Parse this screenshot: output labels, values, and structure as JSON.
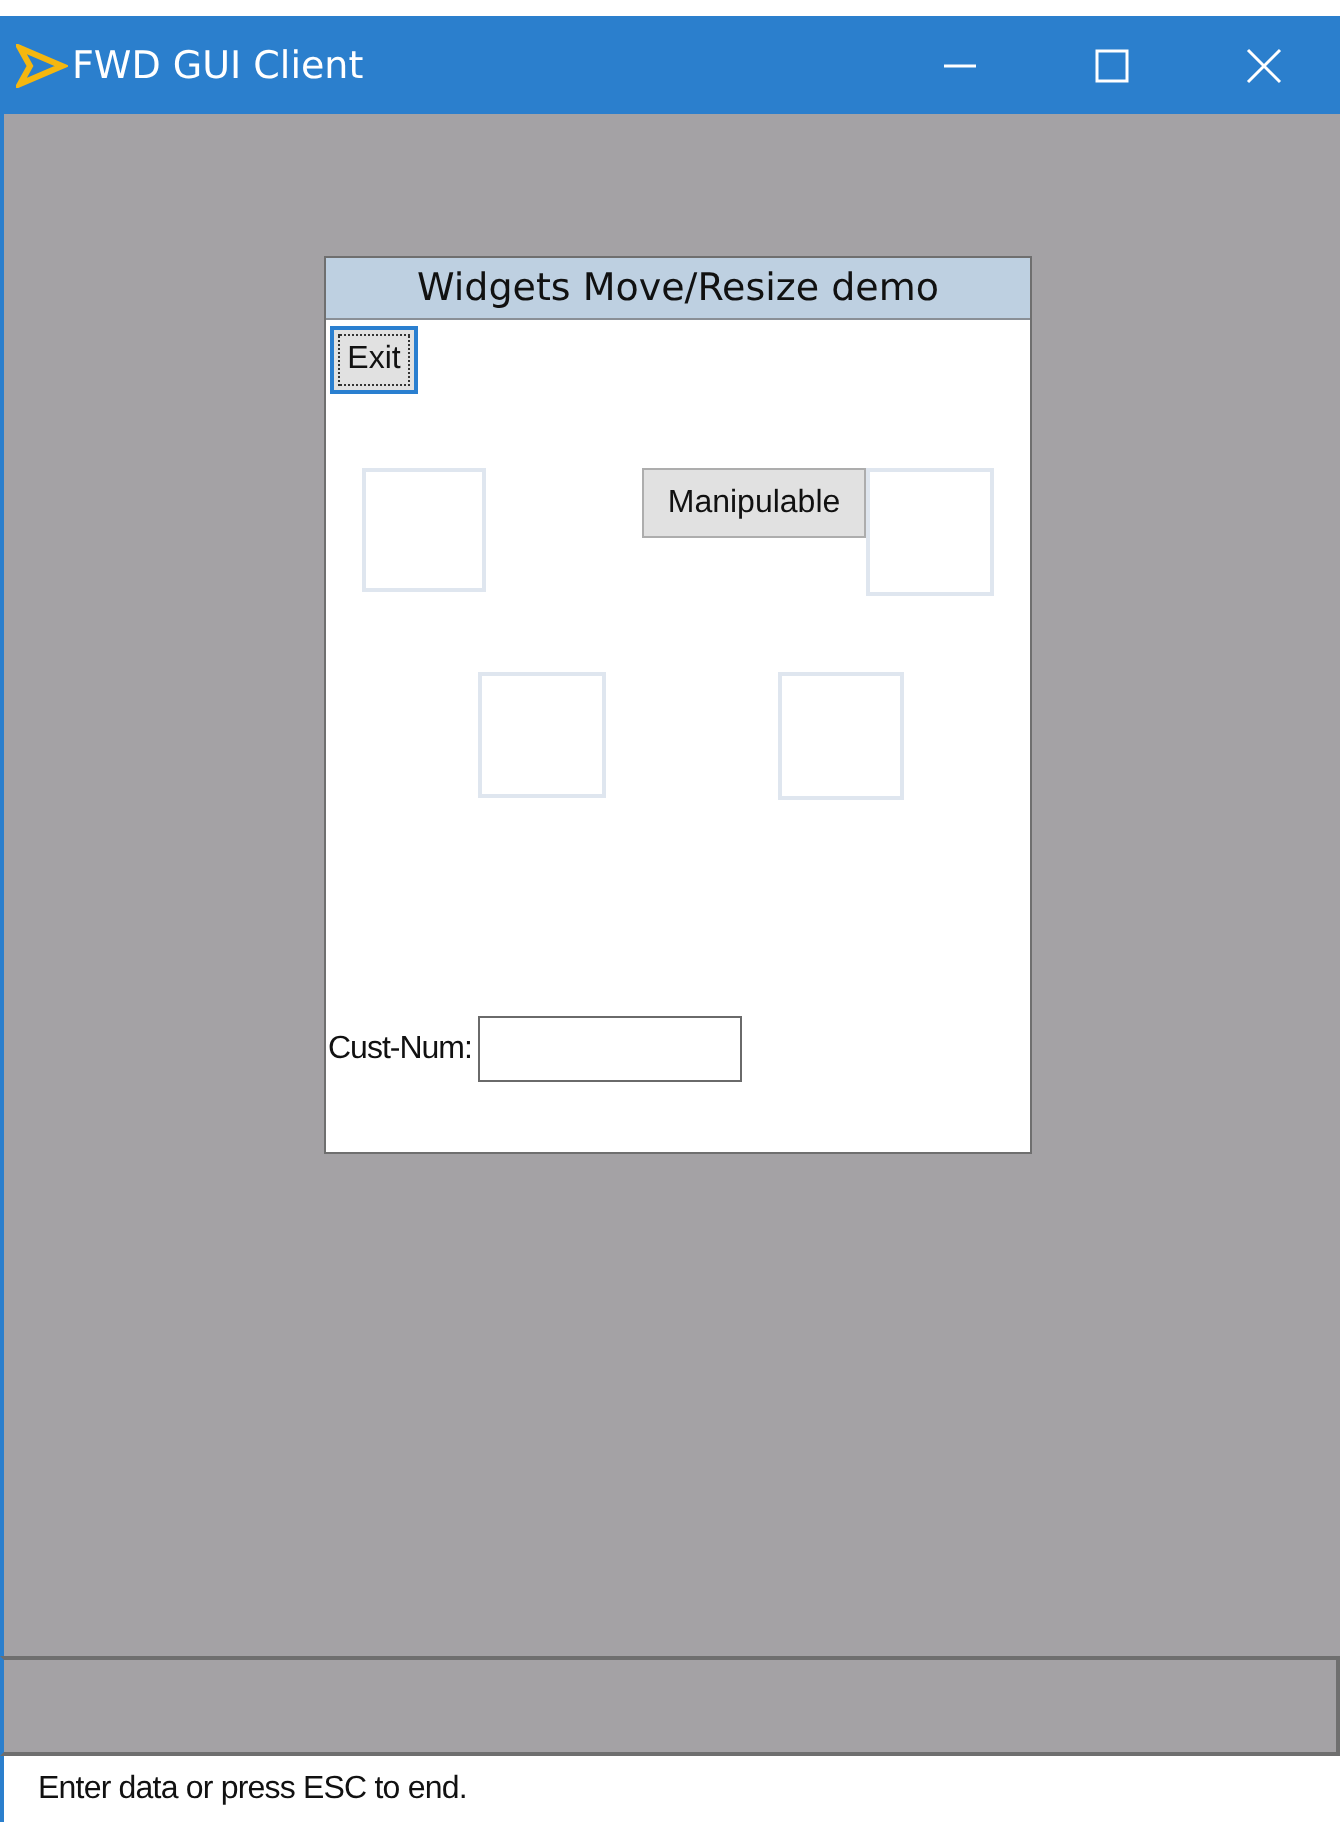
{
  "window": {
    "title": "FWD GUI Client"
  },
  "frame": {
    "title": "Widgets Move/Resize demo",
    "widgets": [
      {
        "kind": "button",
        "label": "Exit",
        "focused": true
      },
      {
        "kind": "box"
      },
      {
        "kind": "button",
        "label": "Manipulable",
        "focused": false
      },
      {
        "kind": "box"
      },
      {
        "kind": "box"
      },
      {
        "kind": "box"
      },
      {
        "kind": "field",
        "label": "Cust-Num:"
      }
    ]
  },
  "status_bar": {
    "text": "Enter data or press ESC to end."
  }
}
